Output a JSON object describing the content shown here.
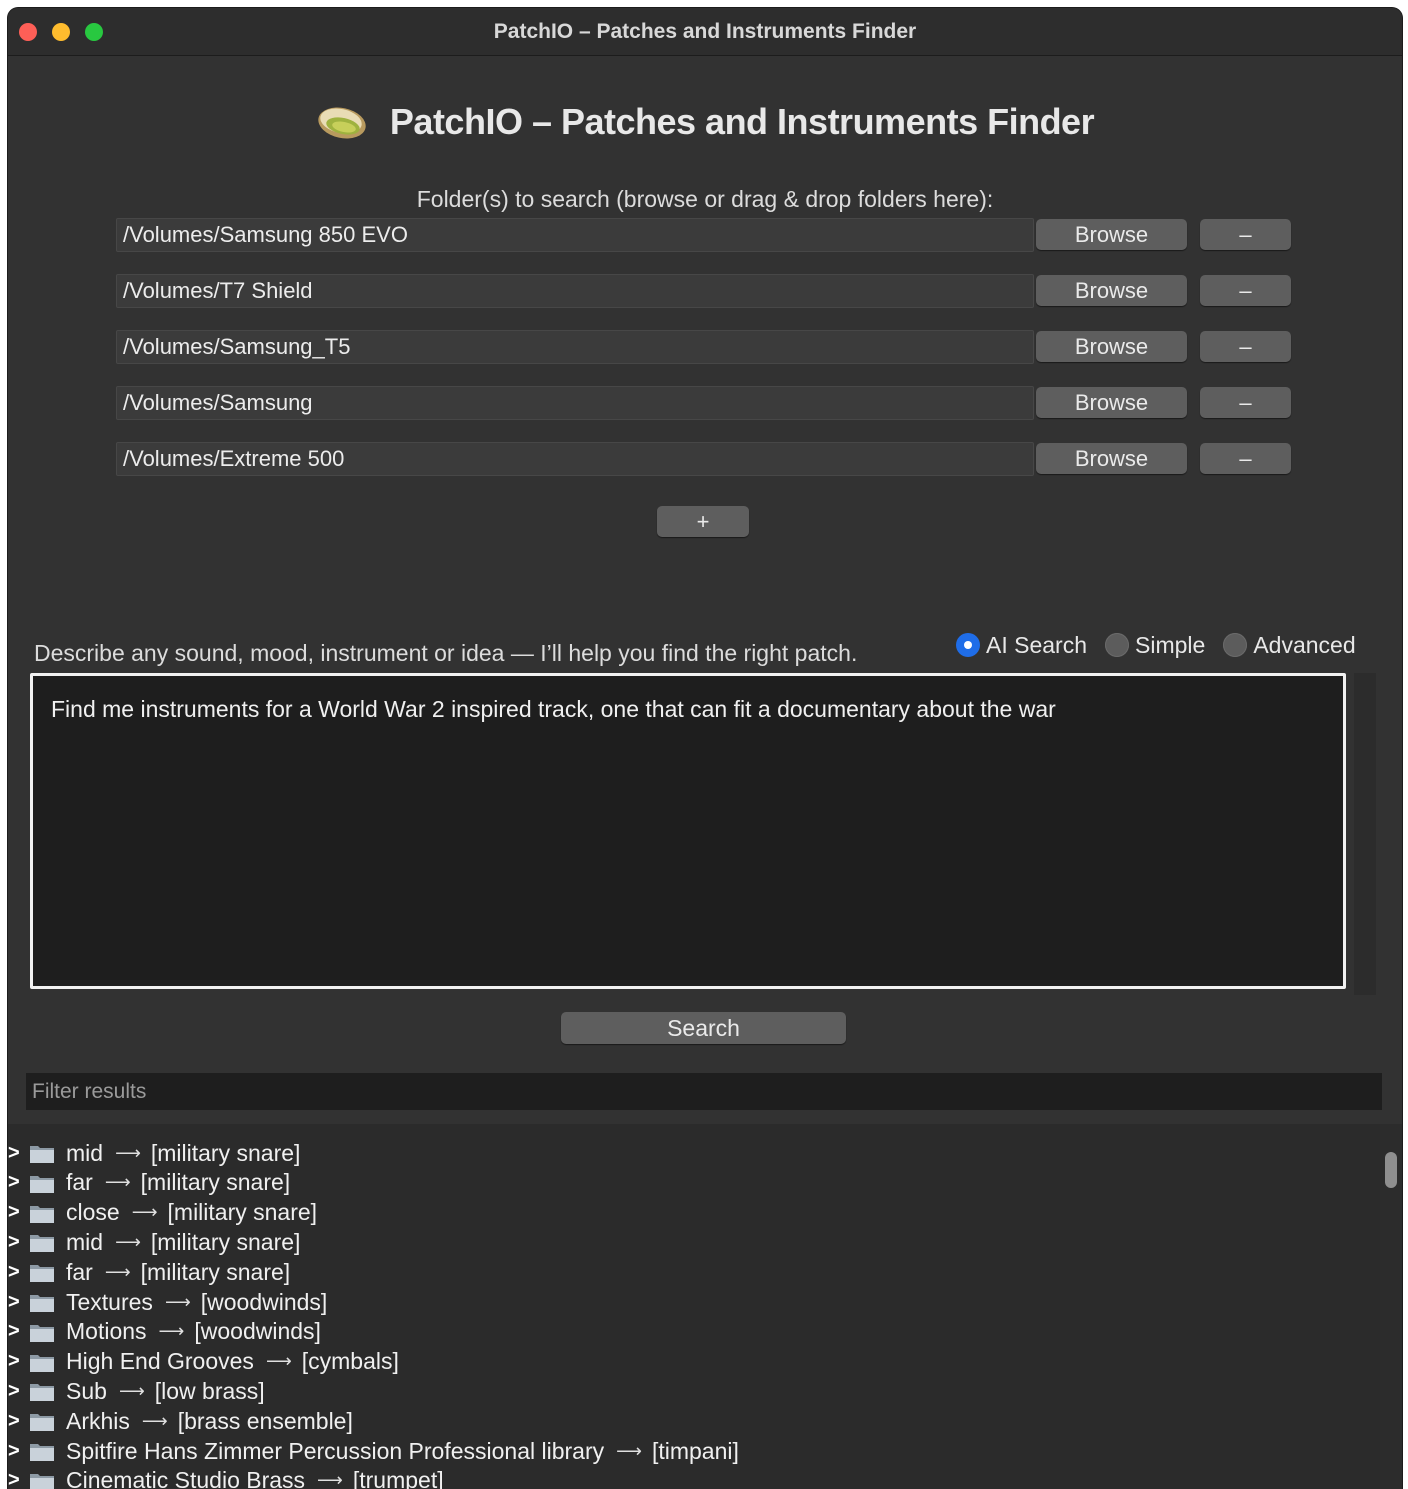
{
  "window": {
    "title": "PatchIO – Patches and Instruments Finder"
  },
  "header": {
    "title": "PatchIO – Patches and Instruments Finder",
    "logo_icon": "pistachio-icon"
  },
  "folders": {
    "label": "Folder(s) to search (browse or drag & drop folders here):",
    "paths": [
      "/Volumes/Samsung 850 EVO",
      "/Volumes/T7 Shield",
      "/Volumes/Samsung_T5",
      "/Volumes/Samsung",
      "/Volumes/Extreme 500"
    ],
    "browse_label": "Browse",
    "remove_label": "–",
    "add_label": "+"
  },
  "search": {
    "describe_text": "Describe any sound, mood, instrument or idea — I’ll help you find the right patch.",
    "modes": [
      {
        "label": "AI Search",
        "selected": true
      },
      {
        "label": "Simple",
        "selected": false
      },
      {
        "label": "Advanced",
        "selected": false
      }
    ],
    "query": "Find me instruments for a World War 2 inspired track, one that can fit a documentary about the war",
    "button_label": "Search",
    "accent_color": "#1f6de8"
  },
  "filter": {
    "placeholder": "Filter results"
  },
  "results": {
    "expander": ">",
    "arrow": "⟶",
    "items": [
      {
        "name": "mid",
        "tag": "[military snare]"
      },
      {
        "name": "far",
        "tag": "[military snare]"
      },
      {
        "name": "close",
        "tag": "[military snare]"
      },
      {
        "name": "mid",
        "tag": "[military snare]"
      },
      {
        "name": "far",
        "tag": "[military snare]"
      },
      {
        "name": "Textures",
        "tag": "[woodwinds]"
      },
      {
        "name": "Motions",
        "tag": "[woodwinds]"
      },
      {
        "name": "High End Grooves",
        "tag": "[cymbals]"
      },
      {
        "name": "Sub",
        "tag": "[low brass]"
      },
      {
        "name": "Arkhis",
        "tag": "[brass ensemble]"
      },
      {
        "name": "Spitfire Hans Zimmer Percussion Professional library",
        "tag": "[timpani]"
      },
      {
        "name": "Cinematic Studio Brass",
        "tag": "[trumpet]"
      }
    ]
  }
}
